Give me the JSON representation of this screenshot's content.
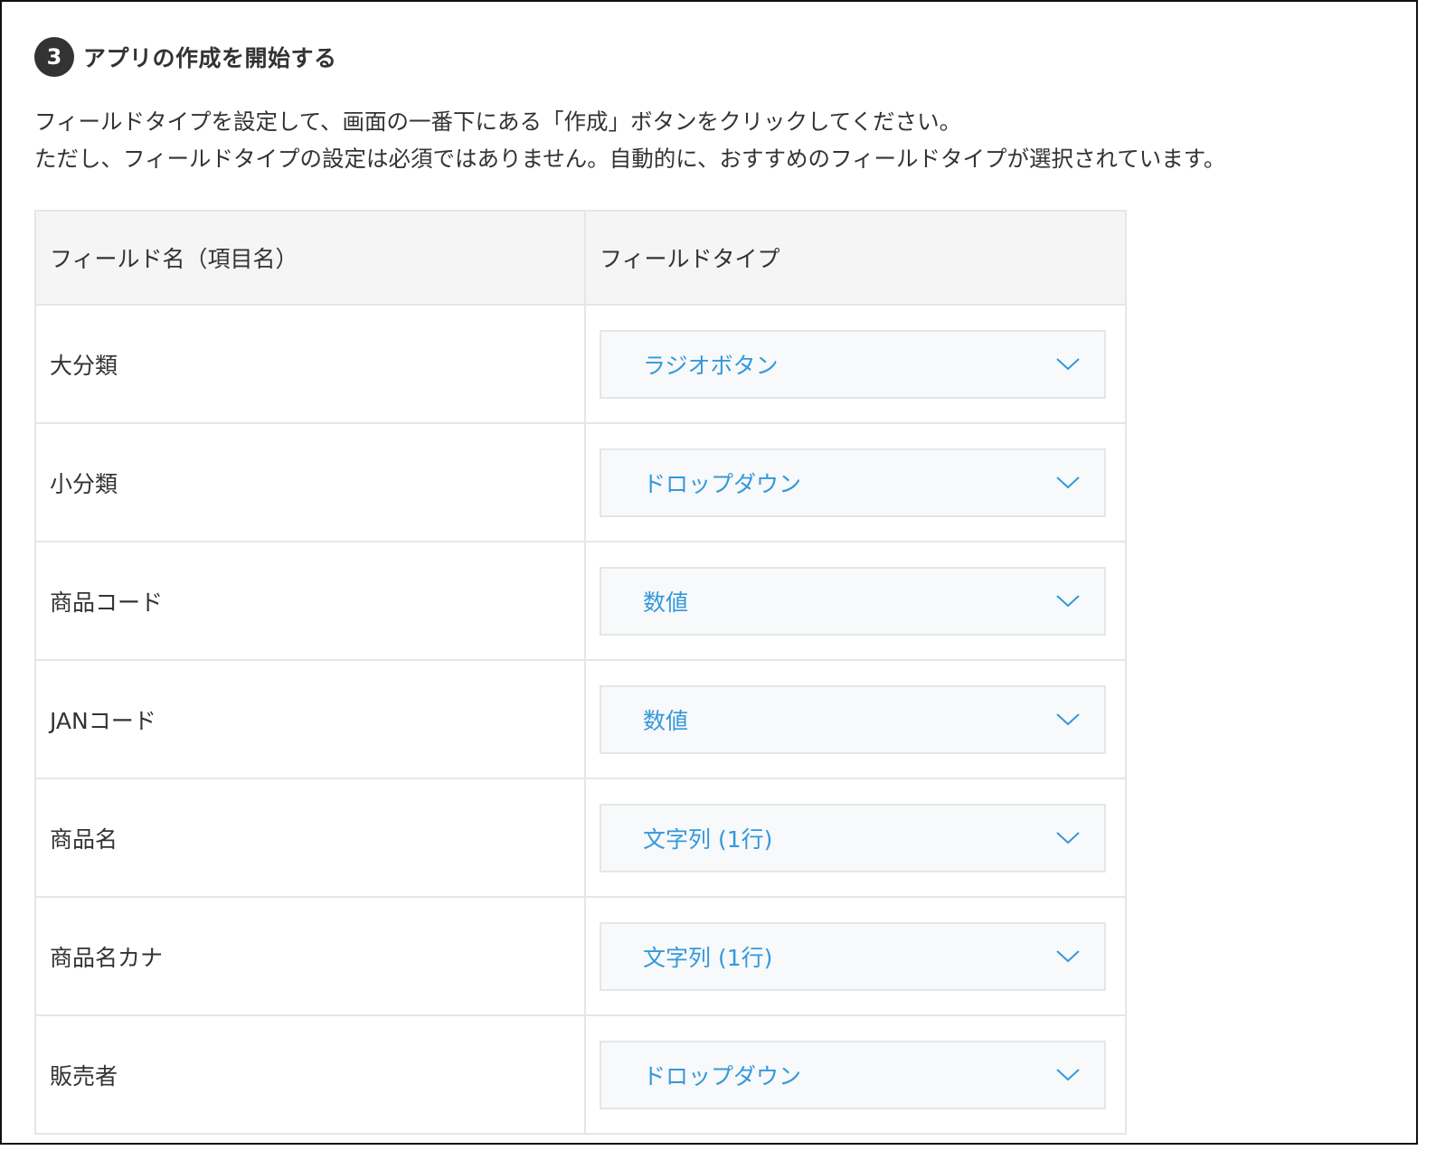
{
  "step": {
    "number": "3",
    "title": "アプリの作成を開始する"
  },
  "description": {
    "line1": "フィールドタイプを設定して、画面の一番下にある「作成」ボタンをクリックしてください。",
    "line2": "ただし、フィールドタイプの設定は必須ではありません。自動的に、おすすめのフィールドタイプが選択されています。"
  },
  "table": {
    "headers": {
      "field_name": "フィールド名（項目名）",
      "field_type": "フィールドタイプ"
    },
    "rows": [
      {
        "name": "大分類",
        "type": "ラジオボタン"
      },
      {
        "name": "小分類",
        "type": "ドロップダウン"
      },
      {
        "name": "商品コード",
        "type": "数値"
      },
      {
        "name": "JANコード",
        "type": "数値"
      },
      {
        "name": "商品名",
        "type": "文字列 (1行)"
      },
      {
        "name": "商品名カナ",
        "type": "文字列 (1行)"
      },
      {
        "name": "販売者",
        "type": "ドロップダウン"
      }
    ]
  },
  "colors": {
    "select_text": "#3498db",
    "chevron": "#3498db",
    "header_bg": "#f5f5f5",
    "border": "#e3e7e8",
    "badge_bg": "#333333"
  },
  "icons": {
    "dropdown": "chevron-down-icon"
  }
}
